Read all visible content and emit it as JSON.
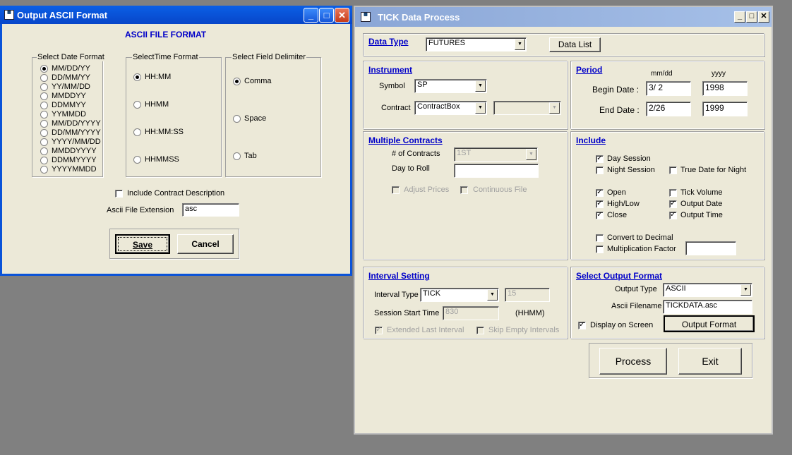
{
  "ascii_window": {
    "title": "Output ASCII Format",
    "heading": "ASCII FILE FORMAT",
    "date_group_title": "Select Date Format",
    "date_formats": [
      "MM/DD/YY",
      "DD/MM/YY",
      "YY/MM/DD",
      "MMDDYY",
      "DDMMYY",
      "YYMMDD",
      "MM/DD/YYYY",
      "DD/MM/YYYY",
      "YYYY/MM/DD",
      "MMDDYYYY",
      "DDMMYYYY",
      "YYYYMMDD"
    ],
    "date_selected": "MM/DD/YY",
    "time_group_title": "SelectTime Format",
    "time_formats": [
      "HH:MM",
      "HHMM",
      "HH:MM:SS",
      "HHMMSS"
    ],
    "time_selected": "HH:MM",
    "delim_group_title": "Select Field Delimiter",
    "delimiters": [
      "Comma",
      "Space",
      "Tab"
    ],
    "delim_selected": "Comma",
    "include_contract_label": "Include Contract Description",
    "include_contract_checked": false,
    "ext_label": "Ascii File Extension",
    "ext_value": "asc",
    "save_label": "Save",
    "cancel_label": "Cancel"
  },
  "tick_window": {
    "title": "TICK Data  Process",
    "data_type": {
      "title": "Data Type",
      "value": "FUTURES",
      "list_button": "Data List"
    },
    "instrument": {
      "title": "Instrument",
      "symbol_label": "Symbol",
      "symbol_value": "SP",
      "contract_label": "Contract",
      "contract_value": "ContractBox",
      "contract2_value": ""
    },
    "period": {
      "title": "Period",
      "col1": "mm/dd",
      "col2": "yyyy",
      "begin_label": "Begin Date  :",
      "begin_md": "3/ 2",
      "begin_y": "1998",
      "end_label": "End Date  :",
      "end_md": "2/26",
      "end_y": "1999"
    },
    "multiple": {
      "title": "Multiple Contracts",
      "num_label": "# of Contracts",
      "num_value": "1ST",
      "roll_label": "Day to Roll",
      "roll_value": "",
      "adjust_label": "Adjust Prices",
      "continuous_label": "Continuous File"
    },
    "include": {
      "title": "Include",
      "day": "Day Session",
      "night": "Night Session",
      "true_date": "True Date for Night",
      "open": "Open",
      "highlow": "High/Low",
      "close": "Close",
      "tick_volume": "Tick Volume",
      "output_date": "Output Date",
      "output_time": "Output Time",
      "convert": "Convert to Decimal",
      "mult": "Multiplication Factor",
      "mult_value": ""
    },
    "interval": {
      "title": "Interval Setting",
      "type_label": "Interval Type",
      "type_value": "TICK",
      "type_num": "15",
      "start_label": "Session Start Time",
      "start_value": "830",
      "start_unit": "(HHMM)",
      "extended_label": "Extended Last Interval",
      "skip_label": "Skip Empty Intervals"
    },
    "output": {
      "title": "Select Output Format",
      "type_label": "Output Type",
      "type_value": "ASCII",
      "fname_label": "Ascii Filename",
      "fname_value": "TICKDATA.asc",
      "display_label": "Display on Screen",
      "format_button": "Output Format"
    },
    "process_label": "Process",
    "exit_label": "Exit"
  }
}
